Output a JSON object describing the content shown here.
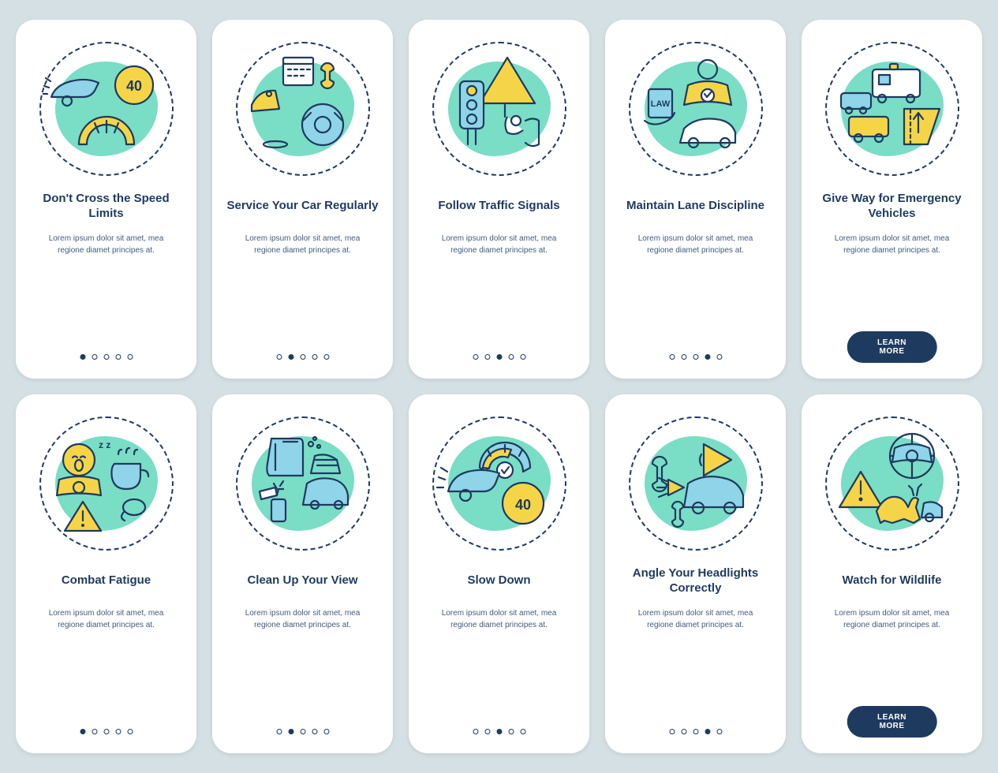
{
  "colors": {
    "navy": "#1e3a5f",
    "teal": "#6bd9c0",
    "yellow": "#f5d547",
    "lightBlue": "#8fd4e8",
    "bg": "#d4e0e3"
  },
  "button_label": "LEARN MORE",
  "lorem": "Lorem ipsum dolor sit amet, mea regione diamet principes at.",
  "cards": [
    {
      "icon": "speed-limit-icon",
      "title": "Don't Cross the Speed Limits",
      "active_dot": 0,
      "has_button": false
    },
    {
      "icon": "car-service-icon",
      "title": "Service Your Car Regularly",
      "active_dot": 1,
      "has_button": false
    },
    {
      "icon": "traffic-signals-icon",
      "title": "Follow Traffic Signals",
      "active_dot": 2,
      "has_button": false
    },
    {
      "icon": "lane-discipline-icon",
      "title": "Maintain Lane Discipline",
      "active_dot": 3,
      "has_button": false
    },
    {
      "icon": "emergency-vehicles-icon",
      "title": "Give Way for Emergency Vehicles",
      "active_dot": null,
      "has_button": true
    },
    {
      "icon": "combat-fatigue-icon",
      "title": "Combat Fatigue",
      "active_dot": 0,
      "has_button": false
    },
    {
      "icon": "clean-view-icon",
      "title": "Clean Up Your View",
      "active_dot": 1,
      "has_button": false
    },
    {
      "icon": "slow-down-icon",
      "title": "Slow Down",
      "active_dot": 2,
      "has_button": false
    },
    {
      "icon": "headlights-icon",
      "title": "Angle Your Headlights Correctly",
      "active_dot": 3,
      "has_button": false
    },
    {
      "icon": "wildlife-icon",
      "title": "Watch for Wildlife",
      "active_dot": null,
      "has_button": true
    }
  ]
}
